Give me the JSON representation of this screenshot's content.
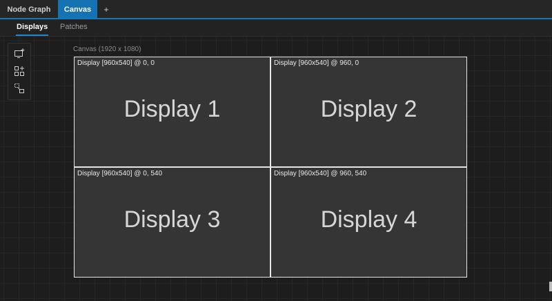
{
  "tabs": {
    "node_graph": "Node Graph",
    "canvas": "Canvas",
    "add": "+"
  },
  "subtabs": {
    "displays": "Displays",
    "patches": "Patches"
  },
  "palette": {
    "tools": [
      "add-display-icon",
      "add-display-grid-icon",
      "link-display-icon"
    ]
  },
  "canvas": {
    "label": "Canvas (1920 x 1080)",
    "displays": [
      {
        "info": "Display [960x540] @ 0, 0",
        "name": "Display 1"
      },
      {
        "info": "Display [960x540] @ 960, 0",
        "name": "Display 2"
      },
      {
        "info": "Display [960x540] @ 0, 540",
        "name": "Display 3"
      },
      {
        "info": "Display [960x540] @ 960, 540",
        "name": "Display 4"
      }
    ]
  },
  "colors": {
    "accent": "#1673b3",
    "display_fill": "#353535",
    "display_border": "#e6e6e6",
    "background": "#1d1d1d"
  }
}
